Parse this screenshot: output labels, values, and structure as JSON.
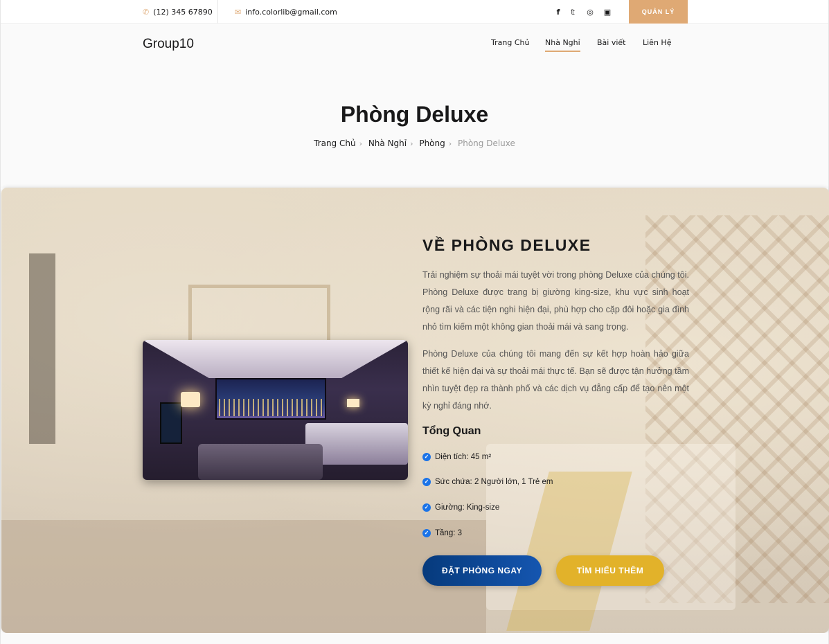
{
  "topbar": {
    "phone": "(12) 345 67890",
    "email": "info.colorlib@gmail.com",
    "social_icons": [
      "facebook-icon",
      "twitter-icon",
      "tripadvisor-icon",
      "instagram-icon"
    ],
    "admin_label": "QUẢN LÝ"
  },
  "nav": {
    "logo": "Group10",
    "items": [
      {
        "label": "Trang Chủ",
        "active": false
      },
      {
        "label": "Nhà Nghỉ",
        "active": true
      },
      {
        "label": "Bài viết",
        "active": false
      },
      {
        "label": "Liên Hệ",
        "active": false
      }
    ]
  },
  "hero": {
    "title": "Phòng Deluxe",
    "breadcrumb": [
      "Trang Chủ",
      "Nhà Nghỉ",
      "Phòng",
      "Phòng Deluxe"
    ]
  },
  "room": {
    "heading": "VỀ PHÒNG DELUXE",
    "paragraph1": "Trải nghiệm sự thoải mái tuyệt vời trong phòng Deluxe của chúng tôi. Phòng Deluxe được trang bị giường king-size, khu vực sinh hoạt rộng rãi và các tiện nghi hiện đại, phù hợp cho cặp đôi hoặc gia đình nhỏ tìm kiếm một không gian thoải mái và sang trọng.",
    "paragraph2": "Phòng Deluxe của chúng tôi mang đến sự kết hợp hoàn hảo giữa thiết kế hiện đại và sự thoải mái thực tế. Bạn sẽ được tận hưởng tầm nhìn tuyệt đẹp ra thành phố và các dịch vụ đẳng cấp để tạo nên một kỳ nghỉ đáng nhớ.",
    "overview_title": "Tổng Quan",
    "features": [
      "Diện tích: 45 m²",
      "Sức chứa: 2 Người lớn, 1 Trẻ em",
      "Giường: King-size",
      "Tầng: 3"
    ],
    "book_label": "ĐẶT PHÒNG NGAY",
    "more_label": "TÌM HIỂU THÊM"
  },
  "colors": {
    "accent": "#dfa974",
    "primary_button": "#0a4391",
    "secondary_button": "#e2b22a",
    "check": "#1a73e8"
  }
}
